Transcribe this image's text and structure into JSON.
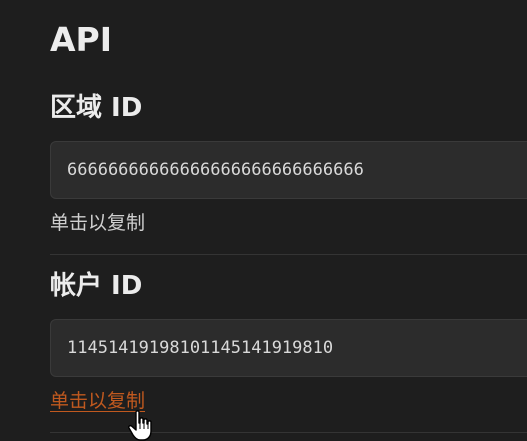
{
  "api": {
    "title": "API"
  },
  "zone": {
    "heading": "区域 ID",
    "value": "66666666666666666666666666666",
    "copy_label": "单击以复制"
  },
  "account": {
    "heading": "帐户 ID",
    "value": "11451419198101145141919810",
    "copy_label": "单击以复制"
  },
  "colors": {
    "background": "#1e1e1e",
    "field_background": "#2c2c2c",
    "link_hover": "#c0591f"
  },
  "cursor": {
    "icon": "hand-pointer-icon"
  }
}
